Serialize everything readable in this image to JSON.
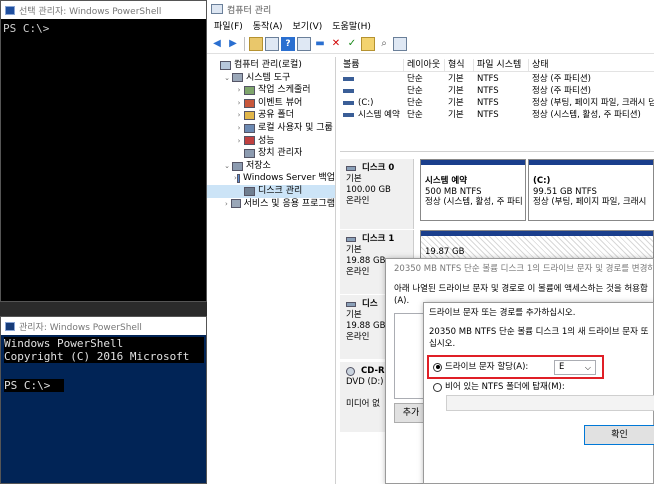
{
  "ps1": {
    "title": "선택 관리자: Windows PowerShell",
    "prompt": "PS C:\\>"
  },
  "ps2": {
    "title": "관리자: Windows PowerShell",
    "lines": [
      "Windows PowerShell",
      "Copyright (C) 2016 Microsoft"
    ],
    "prompt": "PS C:\\>"
  },
  "mmc": {
    "title": "컴퓨터 관리",
    "menu": [
      "파일(F)",
      "동작(A)",
      "보기(V)",
      "도움말(H)"
    ],
    "tree": [
      {
        "label": "컴퓨터 관리(로컬)",
        "indent": 0,
        "twisty": ""
      },
      {
        "label": "시스템 도구",
        "indent": 1,
        "twisty": "⌄"
      },
      {
        "label": "작업 스케줄러",
        "indent": 2,
        "twisty": "›"
      },
      {
        "label": "이벤트 뷰어",
        "indent": 2,
        "twisty": "›"
      },
      {
        "label": "공유 폴더",
        "indent": 2,
        "twisty": "›"
      },
      {
        "label": "로컬 사용자 및 그룹",
        "indent": 2,
        "twisty": "›"
      },
      {
        "label": "성능",
        "indent": 2,
        "twisty": "›"
      },
      {
        "label": "장치 관리자",
        "indent": 2,
        "twisty": ""
      },
      {
        "label": "저장소",
        "indent": 1,
        "twisty": "⌄"
      },
      {
        "label": "Windows Server 백업",
        "indent": 2,
        "twisty": "›"
      },
      {
        "label": "디스크 관리",
        "indent": 2,
        "twisty": "",
        "selected": true
      },
      {
        "label": "서비스 및 응용 프로그램",
        "indent": 1,
        "twisty": "›"
      }
    ],
    "columns": [
      "볼륨",
      "레이아웃",
      "형식",
      "파일 시스템",
      "상태"
    ],
    "rows": [
      {
        "vol": "",
        "layout": "단순",
        "type": "기본",
        "fs": "NTFS",
        "status": "정상 (주 파티션)"
      },
      {
        "vol": "",
        "layout": "단순",
        "type": "기본",
        "fs": "NTFS",
        "status": "정상 (주 파티션)"
      },
      {
        "vol": "(C:)",
        "layout": "단순",
        "type": "기본",
        "fs": "NTFS",
        "status": "정상 (부팅, 페이지 파일, 크래시 덤"
      },
      {
        "vol": "시스템 예약",
        "layout": "단순",
        "type": "기본",
        "fs": "NTFS",
        "status": "정상 (시스템, 활성, 주 파티션)"
      }
    ],
    "disks": [
      {
        "name": "디스크 0",
        "type": "기본",
        "size": "100.00 GB",
        "state": "온라인"
      },
      {
        "name": "디스크 1",
        "type": "기본",
        "size": "19.88 GB",
        "state": "온라인"
      },
      {
        "name": "디스",
        "type": "기본",
        "size": "19.88 GB",
        "state": "온라인"
      },
      {
        "name": "CD-R",
        "type": "DVD (D:)",
        "size": "",
        "state": "미디어 없"
      }
    ],
    "volumes": [
      {
        "name": "시스템 예약",
        "size": "500 MB NTFS",
        "status": "정상 (시스템, 활성, 주 파티"
      },
      {
        "name": "(C:)",
        "size": "99.51 GB NTFS",
        "status": "정상 (부팅, 페이지 파일, 크래시"
      },
      {
        "name": "",
        "size": "19.87 GB",
        "status": ""
      }
    ]
  },
  "dlg1": {
    "title": "20350 MB NTFS 단순 볼륨 디스크 1의 드라이브 문자 및 경로를 변경하",
    "text": "아래 나열된 드라이브 문자 및 경로로 이 볼륨에 액세스하는 것을 허용합",
    "text2": "(A).",
    "add_label": "추가"
  },
  "dlg2": {
    "title": "드라이브 문자 또는 경로를 추가하십시오.",
    "desc": "20350 MB NTFS 단순 볼륨 디스크 1의 새 드라이브 문자 또",
    "desc2": "십시오.",
    "opt1": "드라이브 문자 할당(A):",
    "letter": "E",
    "opt2": "비어 있는 NTFS 폴더에 탑재(M):",
    "ok_label": "확인"
  }
}
